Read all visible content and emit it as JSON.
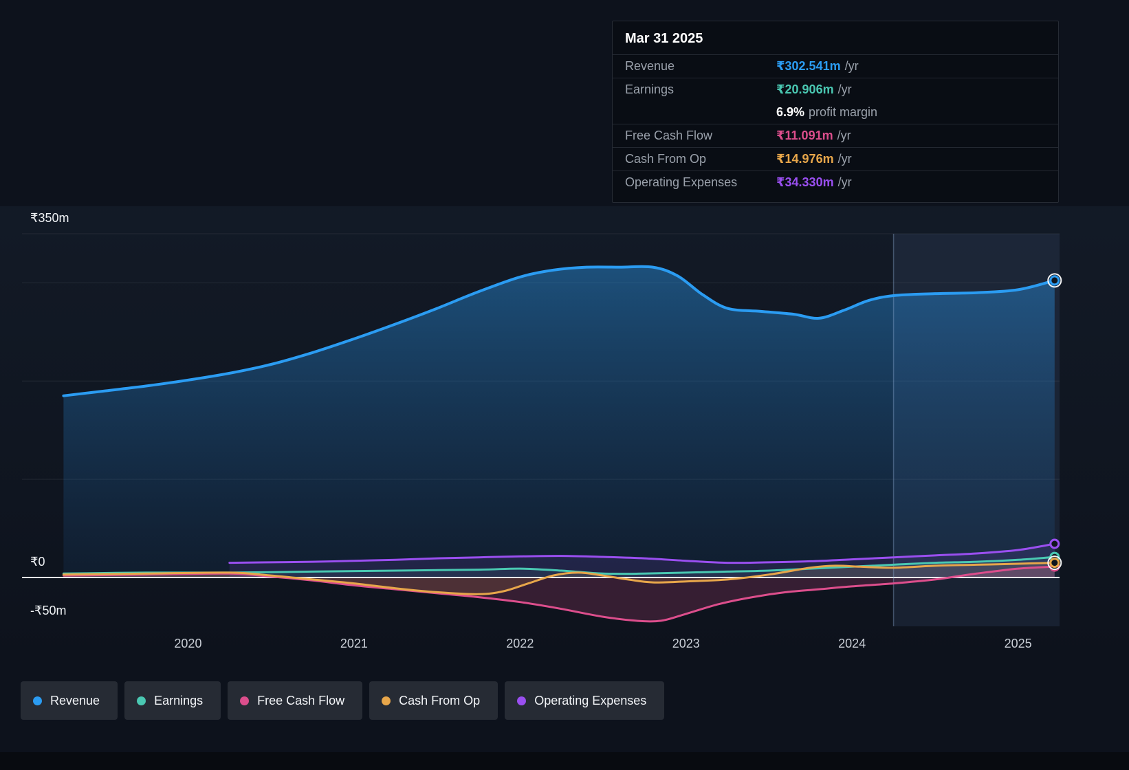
{
  "tooltip": {
    "date": "Mar 31 2025",
    "rows": [
      {
        "label": "Revenue",
        "value": "₹302.541m",
        "unit": "/yr",
        "color": "#2b9cf2",
        "divider": true
      },
      {
        "label": "Earnings",
        "value": "₹20.906m",
        "unit": "/yr",
        "color": "#4ac8b2",
        "divider": true
      },
      {
        "label": "",
        "margin_row": true,
        "value_bold": "6.9%",
        "value_rest": "profit margin",
        "divider": false
      },
      {
        "label": "Free Cash Flow",
        "value": "₹11.091m",
        "unit": "/yr",
        "color": "#dc4e8c",
        "divider": true
      },
      {
        "label": "Cash From Op",
        "value": "₹14.976m",
        "unit": "/yr",
        "color": "#e7a64a",
        "divider": true
      },
      {
        "label": "Operating Expenses",
        "value": "₹34.330m",
        "unit": "/yr",
        "color": "#9a4ff0",
        "divider": true
      }
    ]
  },
  "legend": [
    {
      "label": "Revenue",
      "color": "#2b9cf2"
    },
    {
      "label": "Earnings",
      "color": "#4ac8b2"
    },
    {
      "label": "Free Cash Flow",
      "color": "#dc4e8c"
    },
    {
      "label": "Cash From Op",
      "color": "#e7a64a"
    },
    {
      "label": "Operating Expenses",
      "color": "#9a4ff0"
    }
  ],
  "chart_data": {
    "type": "area",
    "title": "",
    "xlabel": "",
    "ylabel": "",
    "xlim": [
      2019.0,
      2025.25
    ],
    "ylim": [
      -70,
      350
    ],
    "divider_x": 2024.25,
    "gridline_values": [
      350,
      300,
      200,
      100
    ],
    "y_ticks": [
      {
        "label": "₹350m",
        "value": 350
      },
      {
        "label": "₹0",
        "value": 0
      },
      {
        "label": "-₹50m",
        "value": -50
      }
    ],
    "x_ticks": [
      {
        "label": "2020",
        "year": 2020
      },
      {
        "label": "2021",
        "year": 2021
      },
      {
        "label": "2022",
        "year": 2022
      },
      {
        "label": "2023",
        "year": 2023
      },
      {
        "label": "2024",
        "year": 2024
      },
      {
        "label": "2025",
        "year": 2025
      }
    ],
    "series": [
      {
        "name": "Revenue",
        "color": "#2b9cf2",
        "width": 4,
        "fill": "url(#revGrad)",
        "white_ring": true,
        "points": [
          [
            2019.25,
            185
          ],
          [
            2019.5,
            190
          ],
          [
            2019.75,
            195
          ],
          [
            2020,
            201
          ],
          [
            2020.25,
            208
          ],
          [
            2020.5,
            217
          ],
          [
            2020.75,
            229
          ],
          [
            2021,
            243
          ],
          [
            2021.25,
            258
          ],
          [
            2021.5,
            274
          ],
          [
            2021.75,
            291
          ],
          [
            2022,
            306
          ],
          [
            2022.2,
            313
          ],
          [
            2022.4,
            316
          ],
          [
            2022.6,
            316
          ],
          [
            2022.8,
            316
          ],
          [
            2022.95,
            307
          ],
          [
            2023.1,
            288
          ],
          [
            2023.25,
            274
          ],
          [
            2023.45,
            271
          ],
          [
            2023.65,
            268
          ],
          [
            2023.8,
            264
          ],
          [
            2023.95,
            272
          ],
          [
            2024.1,
            282
          ],
          [
            2024.25,
            287
          ],
          [
            2024.5,
            289
          ],
          [
            2024.75,
            290
          ],
          [
            2025,
            293
          ],
          [
            2025.22,
            302.5
          ]
        ]
      },
      {
        "name": "Earnings",
        "color": "#4ac8b2",
        "width": 3,
        "fill": "rgba(74,200,178,0.10)",
        "white_ring": false,
        "points": [
          [
            2019.25,
            4
          ],
          [
            2019.75,
            5
          ],
          [
            2020.25,
            5
          ],
          [
            2020.75,
            6
          ],
          [
            2021.25,
            7
          ],
          [
            2021.75,
            8
          ],
          [
            2022,
            9
          ],
          [
            2022.25,
            7
          ],
          [
            2022.5,
            4
          ],
          [
            2022.75,
            4
          ],
          [
            2023,
            5
          ],
          [
            2023.25,
            6
          ],
          [
            2023.5,
            7
          ],
          [
            2023.75,
            9
          ],
          [
            2024,
            11
          ],
          [
            2024.25,
            13
          ],
          [
            2024.5,
            15
          ],
          [
            2024.75,
            16
          ],
          [
            2025,
            18
          ],
          [
            2025.22,
            20.9
          ]
        ]
      },
      {
        "name": "Free Cash Flow",
        "color": "#dc4e8c",
        "width": 3,
        "fill": "rgba(214,73,134,0.20)",
        "white_ring": false,
        "points": [
          [
            2019.25,
            2
          ],
          [
            2019.75,
            3
          ],
          [
            2020.25,
            4
          ],
          [
            2020.5,
            1
          ],
          [
            2020.75,
            -3
          ],
          [
            2021,
            -8
          ],
          [
            2021.25,
            -12
          ],
          [
            2021.5,
            -16
          ],
          [
            2021.75,
            -20
          ],
          [
            2022,
            -25
          ],
          [
            2022.25,
            -32
          ],
          [
            2022.5,
            -40
          ],
          [
            2022.7,
            -44
          ],
          [
            2022.85,
            -44
          ],
          [
            2023,
            -37
          ],
          [
            2023.2,
            -27
          ],
          [
            2023.4,
            -20
          ],
          [
            2023.6,
            -15
          ],
          [
            2023.8,
            -12
          ],
          [
            2024,
            -9
          ],
          [
            2024.25,
            -6
          ],
          [
            2024.5,
            -2
          ],
          [
            2024.75,
            4
          ],
          [
            2025,
            9
          ],
          [
            2025.22,
            11.1
          ]
        ]
      },
      {
        "name": "Cash From Op",
        "color": "#e7a64a",
        "width": 3,
        "fill": "rgba(232,168,76,0.13)",
        "white_ring": true,
        "points": [
          [
            2019.25,
            3
          ],
          [
            2019.75,
            4
          ],
          [
            2020.25,
            5
          ],
          [
            2020.5,
            2
          ],
          [
            2020.75,
            -2
          ],
          [
            2021,
            -6
          ],
          [
            2021.25,
            -11
          ],
          [
            2021.5,
            -15
          ],
          [
            2021.75,
            -17
          ],
          [
            2021.9,
            -14
          ],
          [
            2022.05,
            -6
          ],
          [
            2022.2,
            2
          ],
          [
            2022.35,
            5
          ],
          [
            2022.5,
            2
          ],
          [
            2022.65,
            -2
          ],
          [
            2022.8,
            -5
          ],
          [
            2023,
            -4
          ],
          [
            2023.25,
            -2
          ],
          [
            2023.5,
            3
          ],
          [
            2023.75,
            10
          ],
          [
            2023.9,
            12
          ],
          [
            2024.05,
            11
          ],
          [
            2024.25,
            10
          ],
          [
            2024.5,
            12
          ],
          [
            2024.75,
            13
          ],
          [
            2025,
            14
          ],
          [
            2025.22,
            15
          ]
        ]
      },
      {
        "name": "Operating Expenses",
        "color": "#9a4ff0",
        "width": 3,
        "fill": "rgba(154,79,240,0.12)",
        "white_ring": false,
        "points": [
          [
            2020.25,
            15
          ],
          [
            2020.5,
            15.5
          ],
          [
            2020.75,
            16
          ],
          [
            2021,
            17
          ],
          [
            2021.25,
            18
          ],
          [
            2021.5,
            19.5
          ],
          [
            2021.75,
            20.5
          ],
          [
            2022,
            21.5
          ],
          [
            2022.25,
            22
          ],
          [
            2022.5,
            21
          ],
          [
            2022.75,
            19.5
          ],
          [
            2023,
            17
          ],
          [
            2023.25,
            15
          ],
          [
            2023.5,
            15.5
          ],
          [
            2023.75,
            16.5
          ],
          [
            2024,
            18.5
          ],
          [
            2024.25,
            20.5
          ],
          [
            2024.5,
            22.5
          ],
          [
            2024.75,
            24.5
          ],
          [
            2025,
            28
          ],
          [
            2025.22,
            34.3
          ]
        ]
      }
    ]
  }
}
